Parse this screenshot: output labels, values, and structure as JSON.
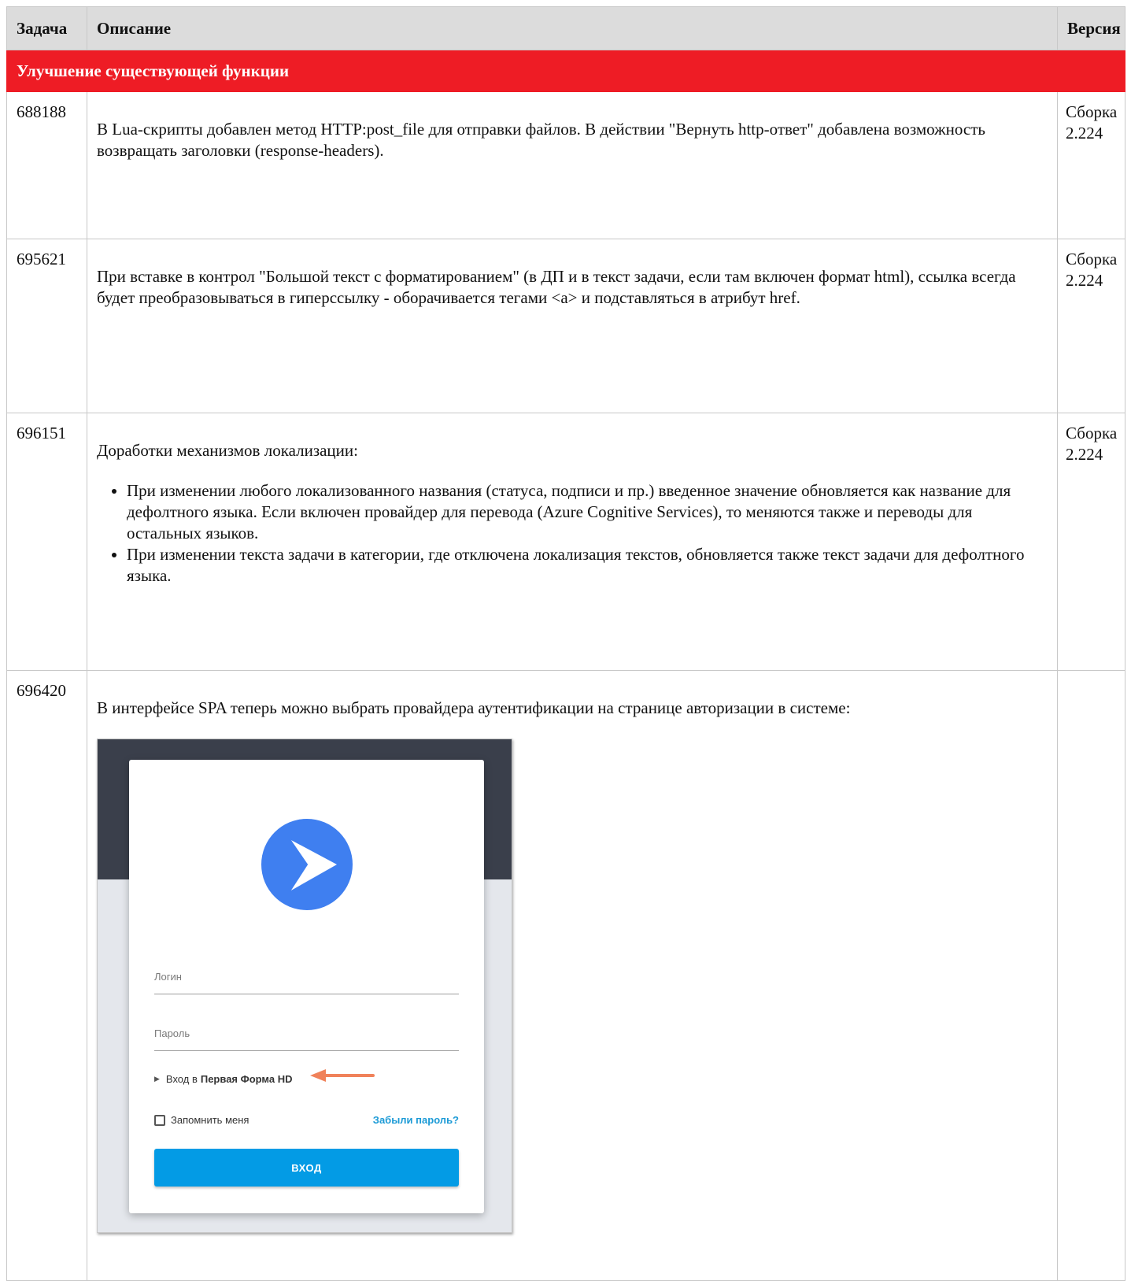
{
  "header": {
    "task": "Задача",
    "description": "Описание",
    "version": "Версия"
  },
  "section_title": "Улучшение существующей функции",
  "rows": [
    {
      "task": "688188",
      "description": "В Lua-скрипты добавлен метод HTTP:post_file для отправки файлов. В действии \"Вернуть http-ответ\" добавлена возможность возвращать заголовки (response-headers).",
      "version": "Сборка 2.224"
    },
    {
      "task": "695621",
      "description": "При вставке в контрол \"Большой текст с форматированием\" (в ДП и в текст задачи, если там включен формат html), ссылка всегда будет преобразовываться в гиперссылку - оборачивается тегами <a> и подставляться в атрибут href.",
      "version": "Сборка 2.224"
    },
    {
      "task": "696151",
      "description": "Доработки механизмов локализации:",
      "bullets": [
        "При изменении любого локализованного названия (статуса, подписи и пр.) введенное значение обновляется как название для дефолтного языка. Если включен провайдер для перевода (Azure Cognitive Services), то меняются также и переводы для остальных языков.",
        "При изменении текста задачи в категории, где отключена локализация текстов, обновляется также текст задачи для дефолтного языка."
      ],
      "version": "Сборка 2.224"
    },
    {
      "task": "696420",
      "description": "В интерфейсе SPA теперь можно выбрать провайдера аутентификации на странице авторизации в системе:",
      "version": "",
      "screenshot": {
        "login_placeholder": "Логин",
        "password_placeholder": "Пароль",
        "provider_prefix": "Вход в",
        "provider_name": "Первая Форма HD",
        "remember_label": "Запомнить меня",
        "forgot_label": "Забыли пароль?",
        "login_button": "ВХОД",
        "logo_icon": "play-triangle-logo-icon",
        "arrow_icon": "left-arrow-icon",
        "colors": {
          "accent": "#039be5",
          "logo": "#3f7ff0",
          "arrow": "#f0825a",
          "section": "#ee1c25",
          "dark_band": "#3a3f4b"
        }
      }
    }
  ]
}
